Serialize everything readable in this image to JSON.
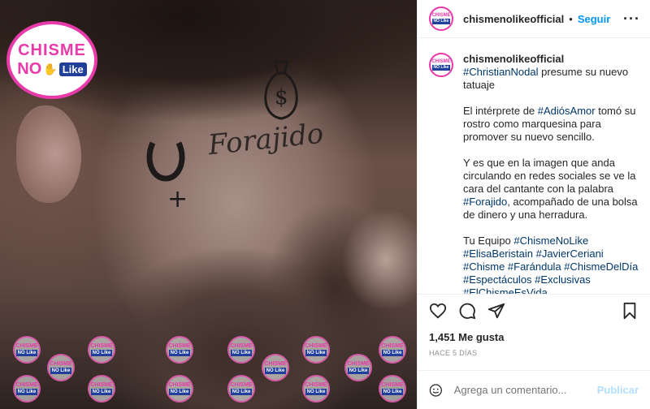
{
  "post": {
    "logo": {
      "line1": "CHISME",
      "line2": "NO",
      "line3": "Like"
    },
    "tattoos": {
      "script": "Forajido",
      "cross": "+"
    },
    "watermark": {
      "line1": "CHISME",
      "line2": "NO Like"
    }
  },
  "header": {
    "username": "chismenolikeofficial",
    "separator": "•",
    "follow_label": "Seguir",
    "more_icon": "more-options-icon"
  },
  "caption": {
    "username": "chismenolikeofficial",
    "p1_tag": "#ChristianNodal",
    "p1_text": "presume su nuevo tatuaje",
    "p2_a": "El intérprete de ",
    "p2_tag": "#AdiósAmor",
    "p2_b": " tomó su rostro como marquesina para promover su nuevo sencillo.",
    "p3_a": "Y es que en la imagen que anda circulando en redes sociales se ve la cara del cantante con la palabra ",
    "p3_tag": "#Forajido",
    "p3_b": ", acompañado de una bolsa de dinero y una herradura.",
    "p4_a": "Tu Equipo ",
    "p4_tags": "#ChismeNoLike #ElisaBeristain #JavierCeriani #Chisme #Farándula #ChismeDelDía #Espectáculos #Exclusivas #ElChismeEsVida #LaBrújulaDelEspectáculo"
  },
  "actions": {
    "like_icon": "heart-icon",
    "comment_icon": "comment-icon",
    "share_icon": "share-icon",
    "save_icon": "bookmark-icon"
  },
  "likes_label": "1,451 Me gusta",
  "date_label": "HACE 5 DÍAS",
  "comment_box": {
    "placeholder": "Agrega un comentario...",
    "post_label": "Publicar",
    "emoji_icon": "emoji-icon"
  },
  "colors": {
    "brand_pink": "#e83aa8",
    "brand_blue": "#1f3f9a",
    "link_blue": "#0095f6",
    "hashtag": "#00376b"
  }
}
